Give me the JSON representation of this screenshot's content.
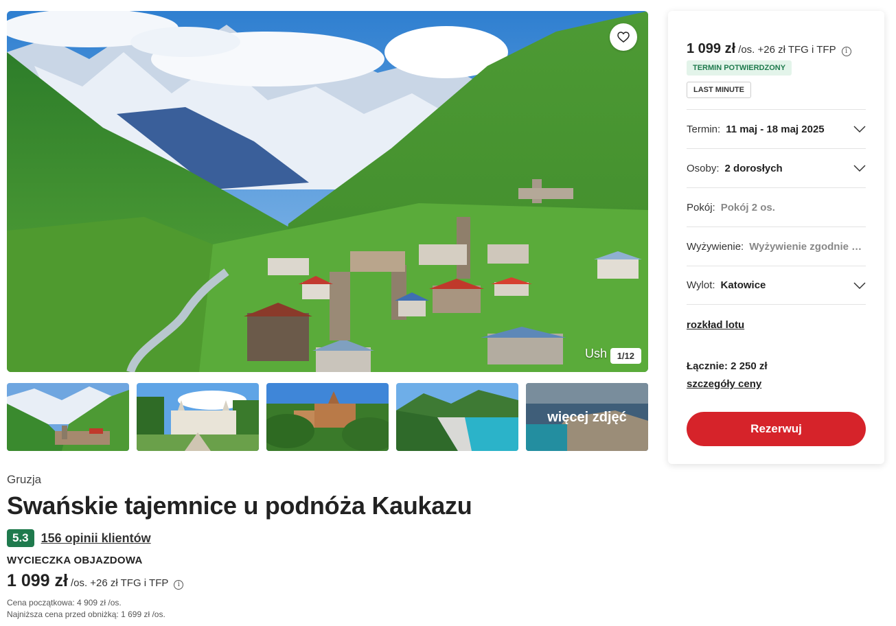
{
  "gallery": {
    "caption": "Ush",
    "counter": "1/12",
    "more_label": "więcej zdjęć",
    "favorite_icon": "heart-icon"
  },
  "offer": {
    "country": "Gruzja",
    "title": "Swańskie tajemnice u podnóża Kaukazu",
    "rating": "5.3",
    "reviews": "156 opinii klientów",
    "type": "WYCIECZKA OBJAZDOWA",
    "price": "1 099 zł",
    "price_suffix": "/os. +26 zł TFG i TFP",
    "original_price": "Cena początkowa: 4 909 zł /os.",
    "lowest_price": "Najniższa cena przed obniżką: 1 699 zł /os."
  },
  "booking": {
    "price": "1 099 zł",
    "price_suffix": "/os. +26 zł TFG i TFP",
    "badge_confirmed": "TERMIN POTWIERDZONY",
    "badge_last_minute": "LAST MINUTE",
    "term_label": "Termin:",
    "term_value": "11 maj - 18 maj 2025",
    "persons_label": "Osoby:",
    "persons_value": "2 dorosłych",
    "room_label": "Pokój:",
    "room_value": "Pokój 2 os.",
    "board_label": "Wyżywienie:",
    "board_value": "Wyżywienie zgodnie z programem",
    "departure_label": "Wylot:",
    "departure_value": "Katowice",
    "flight_schedule": "rozkład lotu",
    "total": "Łącznie: 2 250 zł",
    "price_details": "szczegóły ceny",
    "reserve": "Rezerwuj"
  },
  "colors": {
    "accent_red": "#d6232a",
    "rating_green": "#1f7a4d",
    "badge_green_bg": "#e3f4ea"
  }
}
